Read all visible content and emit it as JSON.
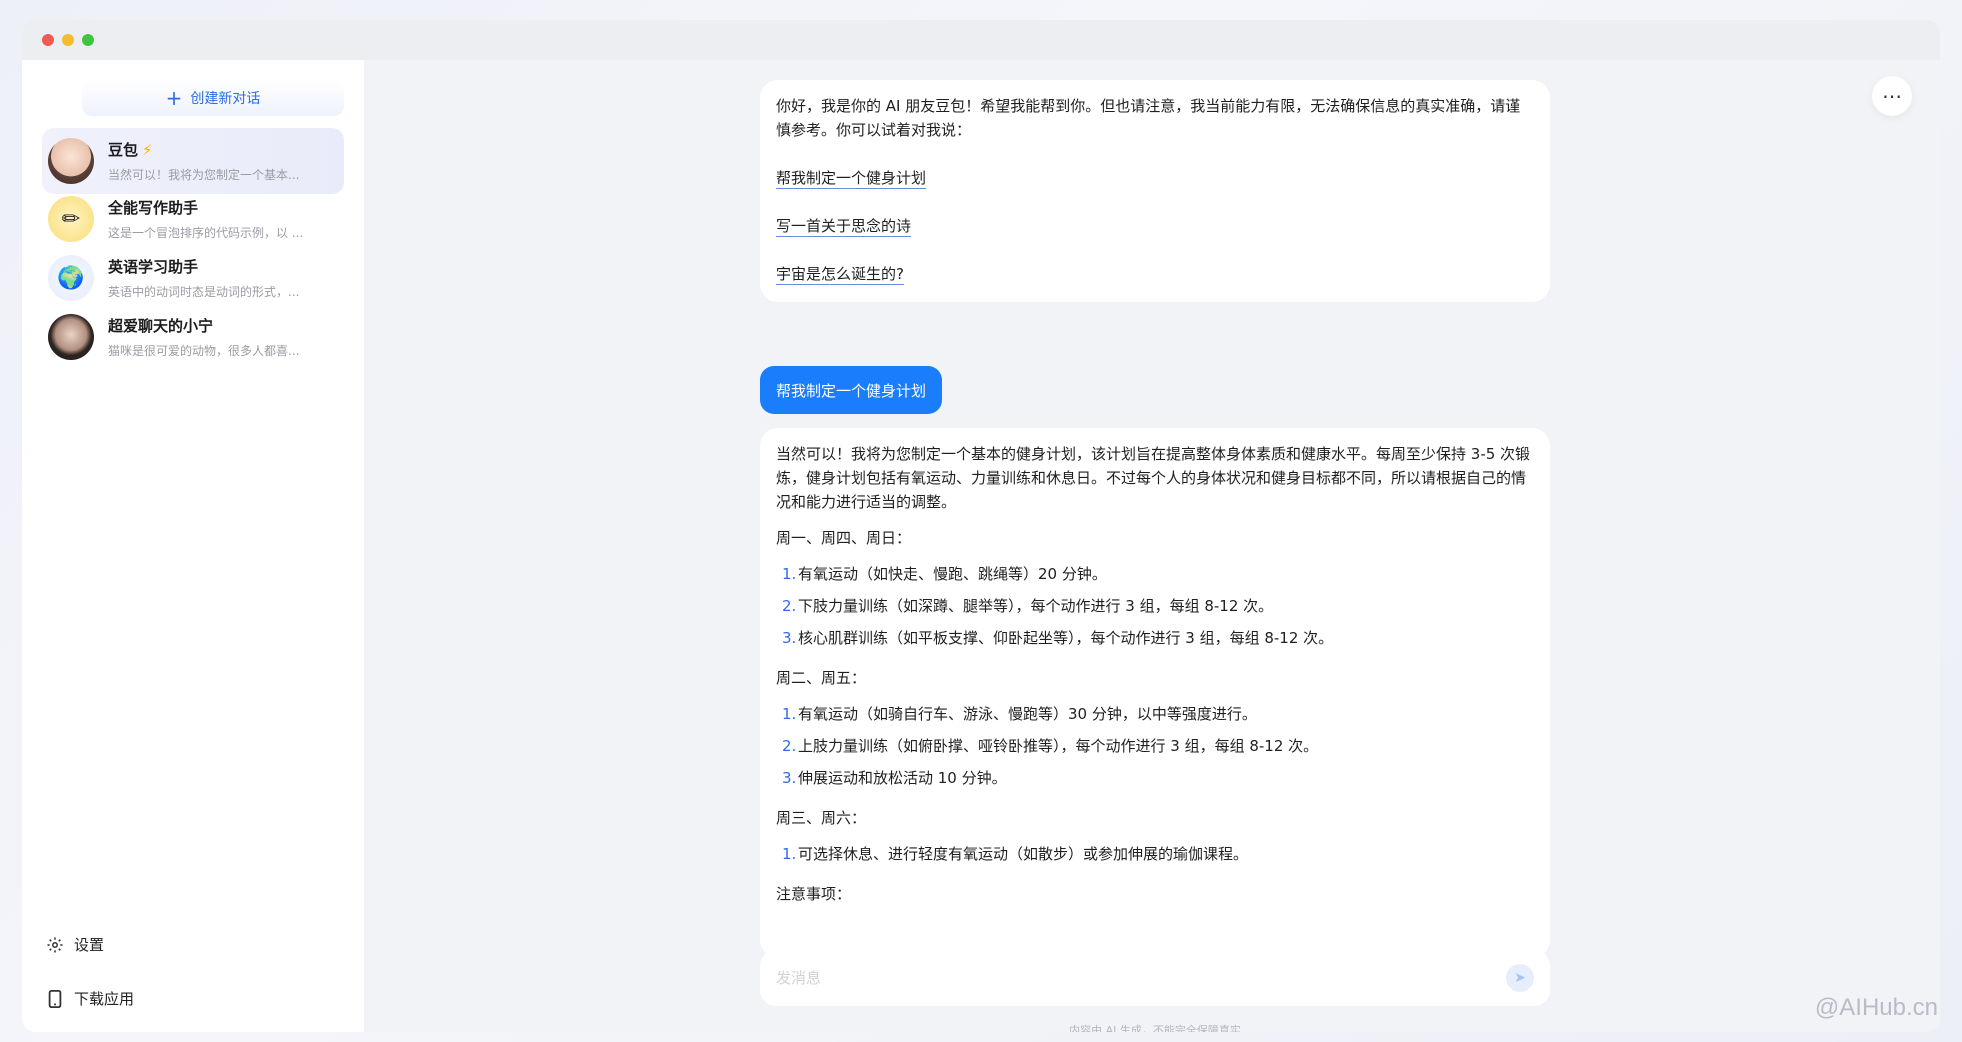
{
  "window": {
    "controls": [
      "close",
      "minimize",
      "maximize"
    ]
  },
  "sidebar": {
    "new_chat_label": "创建新对话",
    "conversations": [
      {
        "title": "豆包",
        "badge": "⚡",
        "preview": "当然可以！我将为您制定一个基本...",
        "avatar": "doubao-avatar",
        "active": true
      },
      {
        "title": "全能写作助手",
        "preview": "这是一个冒泡排序的代码示例，以 ...",
        "avatar": "pencil-icon"
      },
      {
        "title": "英语学习助手",
        "preview": "英语中的动词时态是动词的形式，...",
        "avatar": "globe-icon"
      },
      {
        "title": "超爱聊天的小宁",
        "preview": "猫咪是很可爱的动物，很多人都喜...",
        "avatar": "xiaoning-avatar"
      }
    ],
    "settings_label": "设置",
    "download_label": "下载应用"
  },
  "header": {
    "more_icon": "more-horizontal-icon"
  },
  "chat": {
    "greeting": "你好，我是你的 AI 朋友豆包！希望我能帮到你。但也请注意，我当前能力有限，无法确保信息的真实准确，请谨慎参考。你可以试着对我说：",
    "suggestions": [
      "帮我制定一个健身计划",
      "写一首关于思念的诗",
      "宇宙是怎么诞生的?"
    ],
    "user_message": "帮我制定一个健身计划",
    "answer": {
      "intro": "当然可以！我将为您制定一个基本的健身计划，该计划旨在提高整体身体素质和健康水平。每周至少保持 3-5 次锻炼，健身计划包括有氧运动、力量训练和休息日。不过每个人的身体状况和健身目标都不同，所以请根据自己的情况和能力进行适当的调整。",
      "sections": [
        {
          "heading": "周一、周四、周日：",
          "items": [
            "有氧运动（如快走、慢跑、跳绳等）20 分钟。",
            "下肢力量训练（如深蹲、腿举等），每个动作进行 3 组，每组 8-12 次。",
            "核心肌群训练（如平板支撑、仰卧起坐等），每个动作进行 3 组，每组 8-12 次。"
          ]
        },
        {
          "heading": "周二、周五：",
          "items": [
            "有氧运动（如骑自行车、游泳、慢跑等）30 分钟，以中等强度进行。",
            "上肢力量训练（如俯卧撑、哑铃卧推等），每个动作进行 3 组，每组 8-12 次。",
            "伸展运动和放松活动 10 分钟。"
          ]
        },
        {
          "heading": "周三、周六：",
          "items": [
            "可选择休息、进行轻度有氧运动（如散步）或参加伸展的瑜伽课程。"
          ]
        }
      ],
      "trailing_heading": "注意事项："
    }
  },
  "composer": {
    "placeholder": "发消息",
    "send_icon": "send-icon",
    "disclaimer": "内容由 AI 生成，不能完全保障真实"
  },
  "watermark": "@AIHub.cn"
}
